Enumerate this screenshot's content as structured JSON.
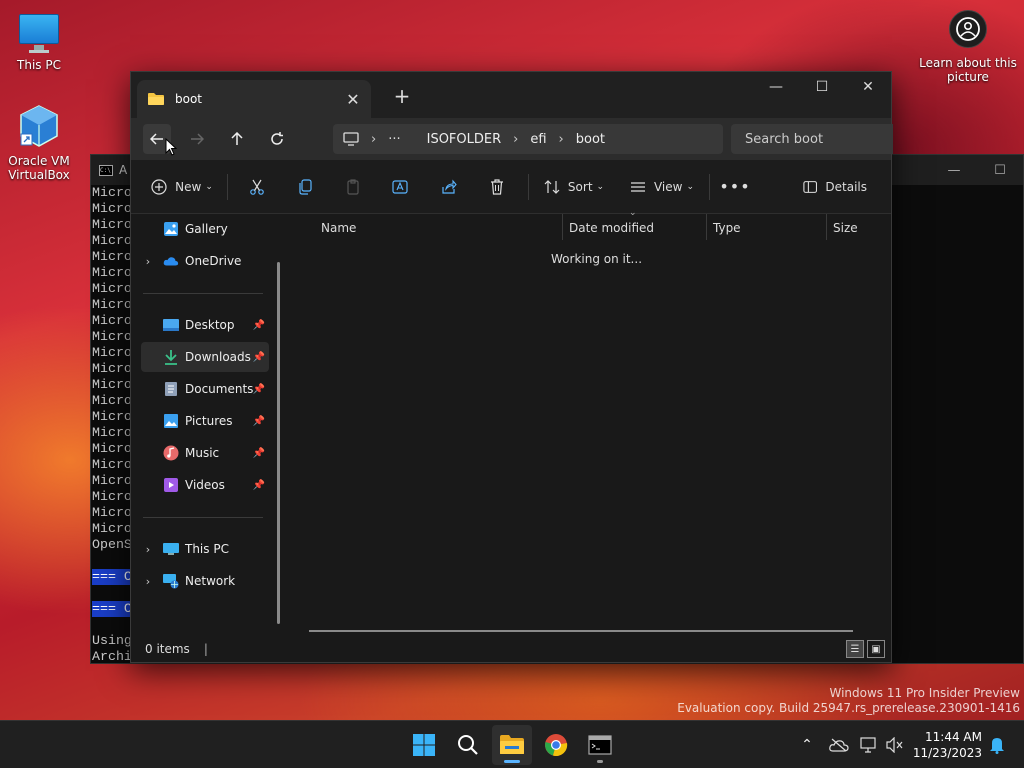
{
  "desktop": {
    "icons": [
      {
        "label": "This PC"
      },
      {
        "label": "Oracle VM VirtualBox"
      }
    ],
    "learn": {
      "label": "Learn about this picture"
    },
    "watermark": {
      "line1": "Windows 11 Pro Insider Preview",
      "line2": "Evaluation copy. Build 25947.rs_prerelease.230901-1416"
    }
  },
  "terminal": {
    "title": "A",
    "lines": [
      "Micro",
      "Micro",
      "Micro",
      "Micro",
      "Micro",
      "Micro",
      "Micro",
      "Micro",
      "Micro",
      "Micro",
      "Micro",
      "Micro",
      "Micro",
      "Micro",
      "Micro",
      "Micro",
      "Micro",
      "Micro",
      "Micro",
      "Micro",
      "Micro",
      "Micro",
      "OpenS",
      "",
      "=== C",
      "",
      "=== C",
      "",
      "Using",
      "Archi"
    ]
  },
  "explorer": {
    "tab": {
      "title": "boot"
    },
    "breadcrumb": [
      "ISOFOLDER",
      "efi",
      "boot"
    ],
    "search_placeholder": "Search boot",
    "toolbar": {
      "new_label": "New",
      "sort_label": "Sort",
      "view_label": "View",
      "details_label": "Details"
    },
    "sidebar": {
      "top": [
        {
          "label": "Gallery"
        },
        {
          "label": "OneDrive"
        }
      ],
      "quick": [
        {
          "label": "Desktop"
        },
        {
          "label": "Downloads"
        },
        {
          "label": "Documents"
        },
        {
          "label": "Pictures"
        },
        {
          "label": "Music"
        },
        {
          "label": "Videos"
        }
      ],
      "bottom": [
        {
          "label": "This PC"
        },
        {
          "label": "Network"
        }
      ]
    },
    "columns": [
      "Name",
      "Date modified",
      "Type",
      "Size"
    ],
    "status_message": "Working on it...",
    "item_count": "0 items"
  },
  "taskbar": {
    "time": "11:44 AM",
    "date": "11/23/2023"
  },
  "colors": {
    "accent": "#5ab4ff",
    "selection": "#1a3ec8",
    "window_bg": "#191919"
  }
}
